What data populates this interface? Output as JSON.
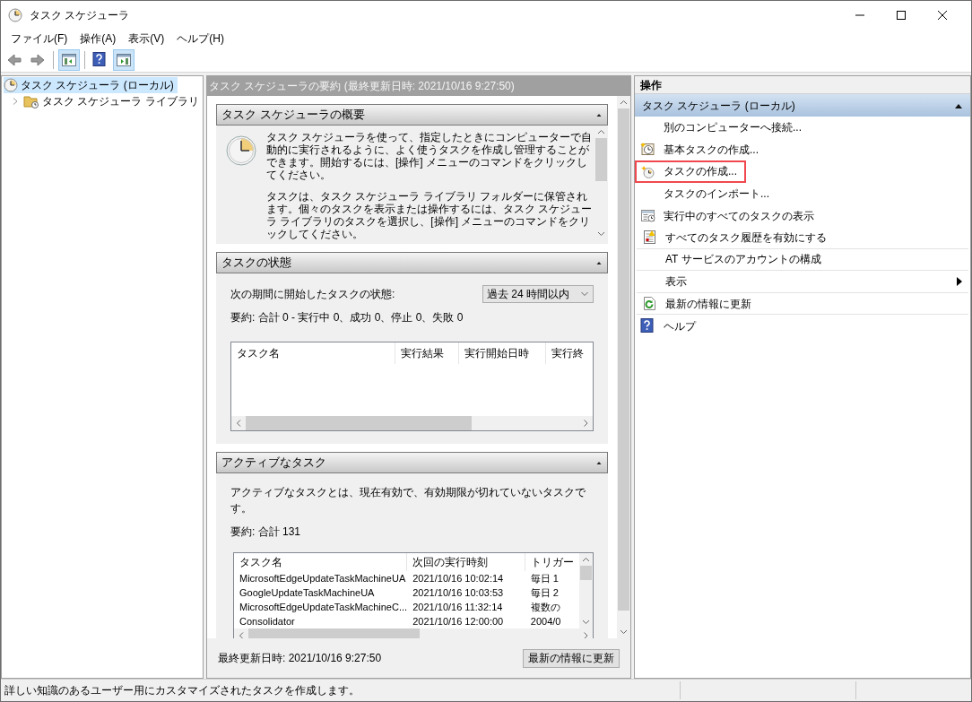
{
  "window": {
    "title": "タスク スケジューラ"
  },
  "menu": [
    "ファイル(F)",
    "操作(A)",
    "表示(V)",
    "ヘルプ(H)"
  ],
  "toolbar": [
    {
      "kind": "back",
      "disabled": true
    },
    {
      "kind": "forward",
      "disabled": true
    },
    {
      "kind": "tree-pane",
      "selected": true
    },
    {
      "kind": "help",
      "selected": false
    },
    {
      "kind": "action-pane",
      "selected": true
    }
  ],
  "tree": [
    {
      "label": "タスク スケジューラ (ローカル)",
      "selected": true,
      "children": [
        {
          "label": "タスク スケジューラ ライブラリ",
          "selected": false,
          "expanded": false
        }
      ]
    }
  ],
  "center": {
    "header": "タスク スケジューラの要約 (最終更新日時: 2021/10/16 9:27:50)",
    "sections": [
      {
        "kind": "overview",
        "title": "タスク スケジューラの概要",
        "expanded": true,
        "paragraphs": [
          "タスク スケジューラを使って、指定したときにコンピューターで自動的に実行されるように、よく使うタスクを作成し管理することができます。開始するには、[操作] メニューのコマンドをクリックしてください。",
          "タスクは、タスク スケジューラ ライブラリ フォルダーに保管されます。個々のタスクを表示または操作するには、タスク スケジューラ ライブラリのタスクを選択し、[操作] メニューのコマンドをクリックしてください。"
        ]
      },
      {
        "kind": "status",
        "title": "タスクの状態",
        "expanded": true,
        "filter_label": "次の期間に開始したタスクの状態:",
        "filter_value": "過去 24 時間以内",
        "summary": "要約: 合計 0 - 実行中 0、成功 0、停止 0、失敗 0",
        "table": {
          "columns": [
            "タスク名",
            "実行結果",
            "実行開始日時",
            "実行終"
          ]
        }
      },
      {
        "kind": "active",
        "title": "アクティブなタスク",
        "expanded": true,
        "description": "アクティブなタスクとは、現在有効で、有効期限が切れていないタスクです。",
        "summary": "要約: 合計 131",
        "table": {
          "columns": [
            "タスク名",
            "次回の実行時刻",
            "トリガー"
          ],
          "rows": [
            [
              "MicrosoftEdgeUpdateTaskMachineUA",
              "2021/10/16 10:02:14",
              "毎日 1"
            ],
            [
              "GoogleUpdateTaskMachineUA",
              "2021/10/16 10:03:53",
              "毎日 2"
            ],
            [
              "MicrosoftEdgeUpdateTaskMachineC...",
              "2021/10/16 11:32:14",
              "複数の"
            ],
            [
              "Consolidator",
              "2021/10/16 12:00:00",
              "2004/0"
            ]
          ]
        }
      }
    ],
    "footer": {
      "updated": "最終更新日時: 2021/10/16 9:27:50",
      "refresh_button": "最新の情報に更新"
    }
  },
  "actions": {
    "title": "操作",
    "group": "タスク スケジューラ (ローカル)",
    "group_expanded": true,
    "items": [
      {
        "kind": "plain",
        "label": "別のコンピューターへ接続..."
      },
      {
        "kind": "basic-task",
        "label": "基本タスクの作成..."
      },
      {
        "kind": "create-task",
        "label": "タスクの作成...",
        "highlighted": true
      },
      {
        "kind": "plain",
        "label": "タスクのインポート..."
      },
      {
        "kind": "running",
        "label": "実行中のすべてのタスクの表示"
      },
      {
        "kind": "history",
        "label": "すべてのタスク履歴を有効にする",
        "separator": true
      },
      {
        "kind": "plain",
        "label": "AT サービスのアカウントの構成",
        "separator": true
      },
      {
        "kind": "plain",
        "label": "表示",
        "submenu": true,
        "separator": true
      },
      {
        "kind": "refresh",
        "label": "最新の情報に更新",
        "separator": true
      },
      {
        "kind": "help",
        "label": "ヘルプ"
      }
    ]
  },
  "status_bar": {
    "text": "詳しい知識のあるユーザー用にカスタマイズされたタスクを作成します。"
  }
}
